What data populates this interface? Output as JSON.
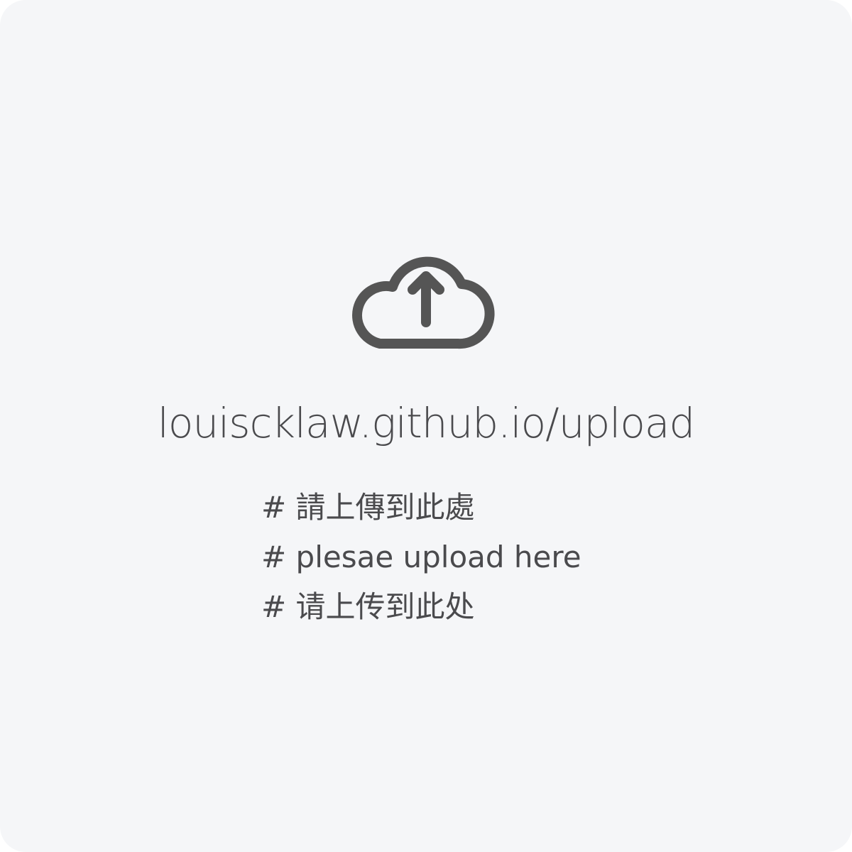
{
  "upload_area": {
    "icon": "cloud-upload-icon",
    "url": "louiscklaw.github.io/upload",
    "instructions": [
      "# 請上傳到此處",
      "# plesae upload here",
      "# 请上传到此处"
    ]
  },
  "colors": {
    "background": "#f5f6f8",
    "text": "#4a4a4d",
    "icon": "#555555"
  }
}
